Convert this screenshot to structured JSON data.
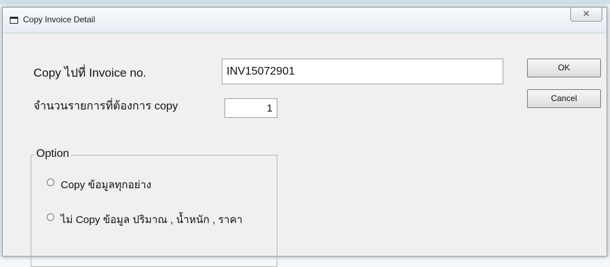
{
  "dialog": {
    "title": "Copy Invoice Detail",
    "close_symbol": "☒"
  },
  "form": {
    "invoice_label": "Copy ไปที่ Invoice no.",
    "invoice_value": "INV15072901",
    "count_label": "จำนวนรายการที่ต้องการ copy",
    "count_value": "1"
  },
  "buttons": {
    "ok": "OK",
    "cancel": "Cancel"
  },
  "option_group": {
    "legend": "Option",
    "options": [
      {
        "label": "Copy ข้อมูลทุกอย่าง",
        "selected": false
      },
      {
        "label": "ไม่ Copy ข้อมูล ปริมาณ , น้ำหนัก , ราคา",
        "selected": false
      }
    ]
  },
  "icons": {
    "window_icon": "window-icon",
    "close_icon": "close-icon"
  }
}
